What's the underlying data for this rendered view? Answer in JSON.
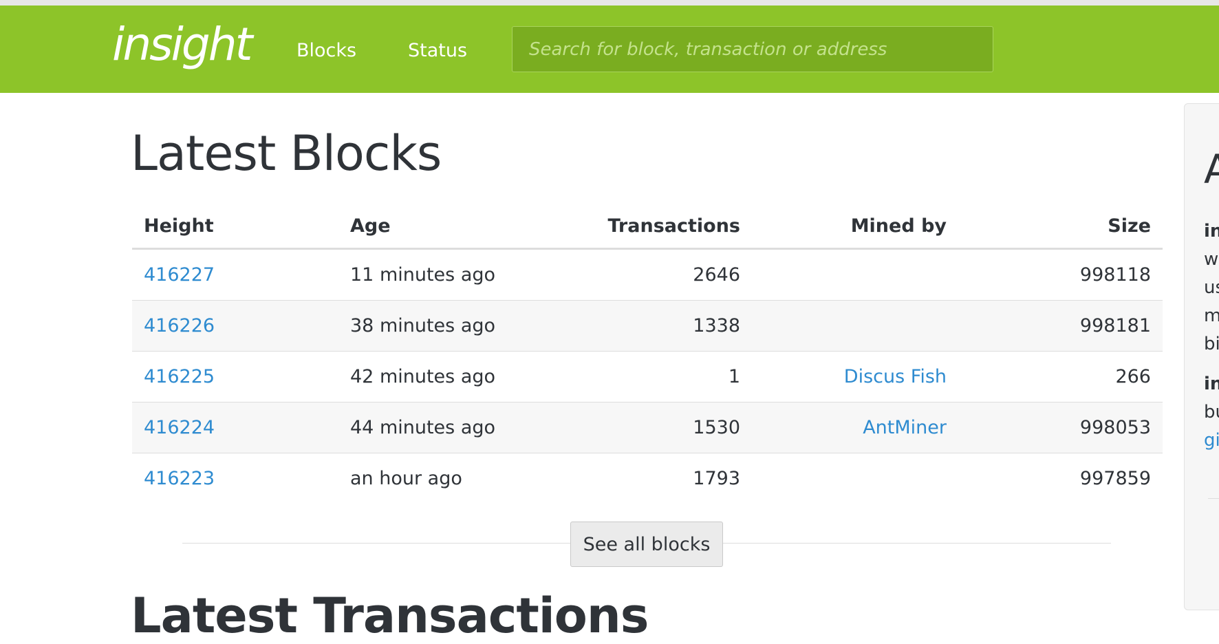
{
  "navbar": {
    "brand": "insight",
    "links": [
      {
        "label": "Blocks"
      },
      {
        "label": "Status"
      }
    ],
    "search": {
      "placeholder": "Search for block, transaction or address",
      "value": ""
    }
  },
  "main": {
    "title": "Latest Blocks",
    "table": {
      "headers": {
        "height": "Height",
        "age": "Age",
        "transactions": "Transactions",
        "mined_by": "Mined by",
        "size": "Size"
      },
      "rows": [
        {
          "height": "416227",
          "age": "11 minutes ago",
          "transactions": "2646",
          "mined_by": "",
          "size": "998118"
        },
        {
          "height": "416226",
          "age": "38 minutes ago",
          "transactions": "1338",
          "mined_by": "",
          "size": "998181"
        },
        {
          "height": "416225",
          "age": "42 minutes ago",
          "transactions": "1",
          "mined_by": "Discus Fish",
          "size": "266"
        },
        {
          "height": "416224",
          "age": "44 minutes ago",
          "transactions": "1530",
          "mined_by": "AntMiner",
          "size": "998053"
        },
        {
          "height": "416223",
          "age": "an hour ago",
          "transactions": "1793",
          "mined_by": "",
          "size": "997859"
        }
      ]
    },
    "see_all_label": "See all blocks",
    "next_section_title": "Latest Transactions"
  },
  "sidebar": {
    "title": "A",
    "lines": [
      {
        "text": "in",
        "style": "bold"
      },
      {
        "text": "w",
        "style": "normal"
      },
      {
        "text": "us",
        "style": "normal"
      },
      {
        "text": "m",
        "style": "normal"
      },
      {
        "text": "bi",
        "style": "normal"
      },
      {
        "text": "in",
        "style": "bold"
      },
      {
        "text": "bu",
        "style": "normal"
      },
      {
        "text": "gi",
        "style": "link"
      }
    ]
  },
  "colors": {
    "navbar": "#8dc429",
    "search_bg": "#7aad20",
    "link": "#2e8bd0",
    "text": "#2f3338",
    "striped_row": "#f7f7f7"
  }
}
